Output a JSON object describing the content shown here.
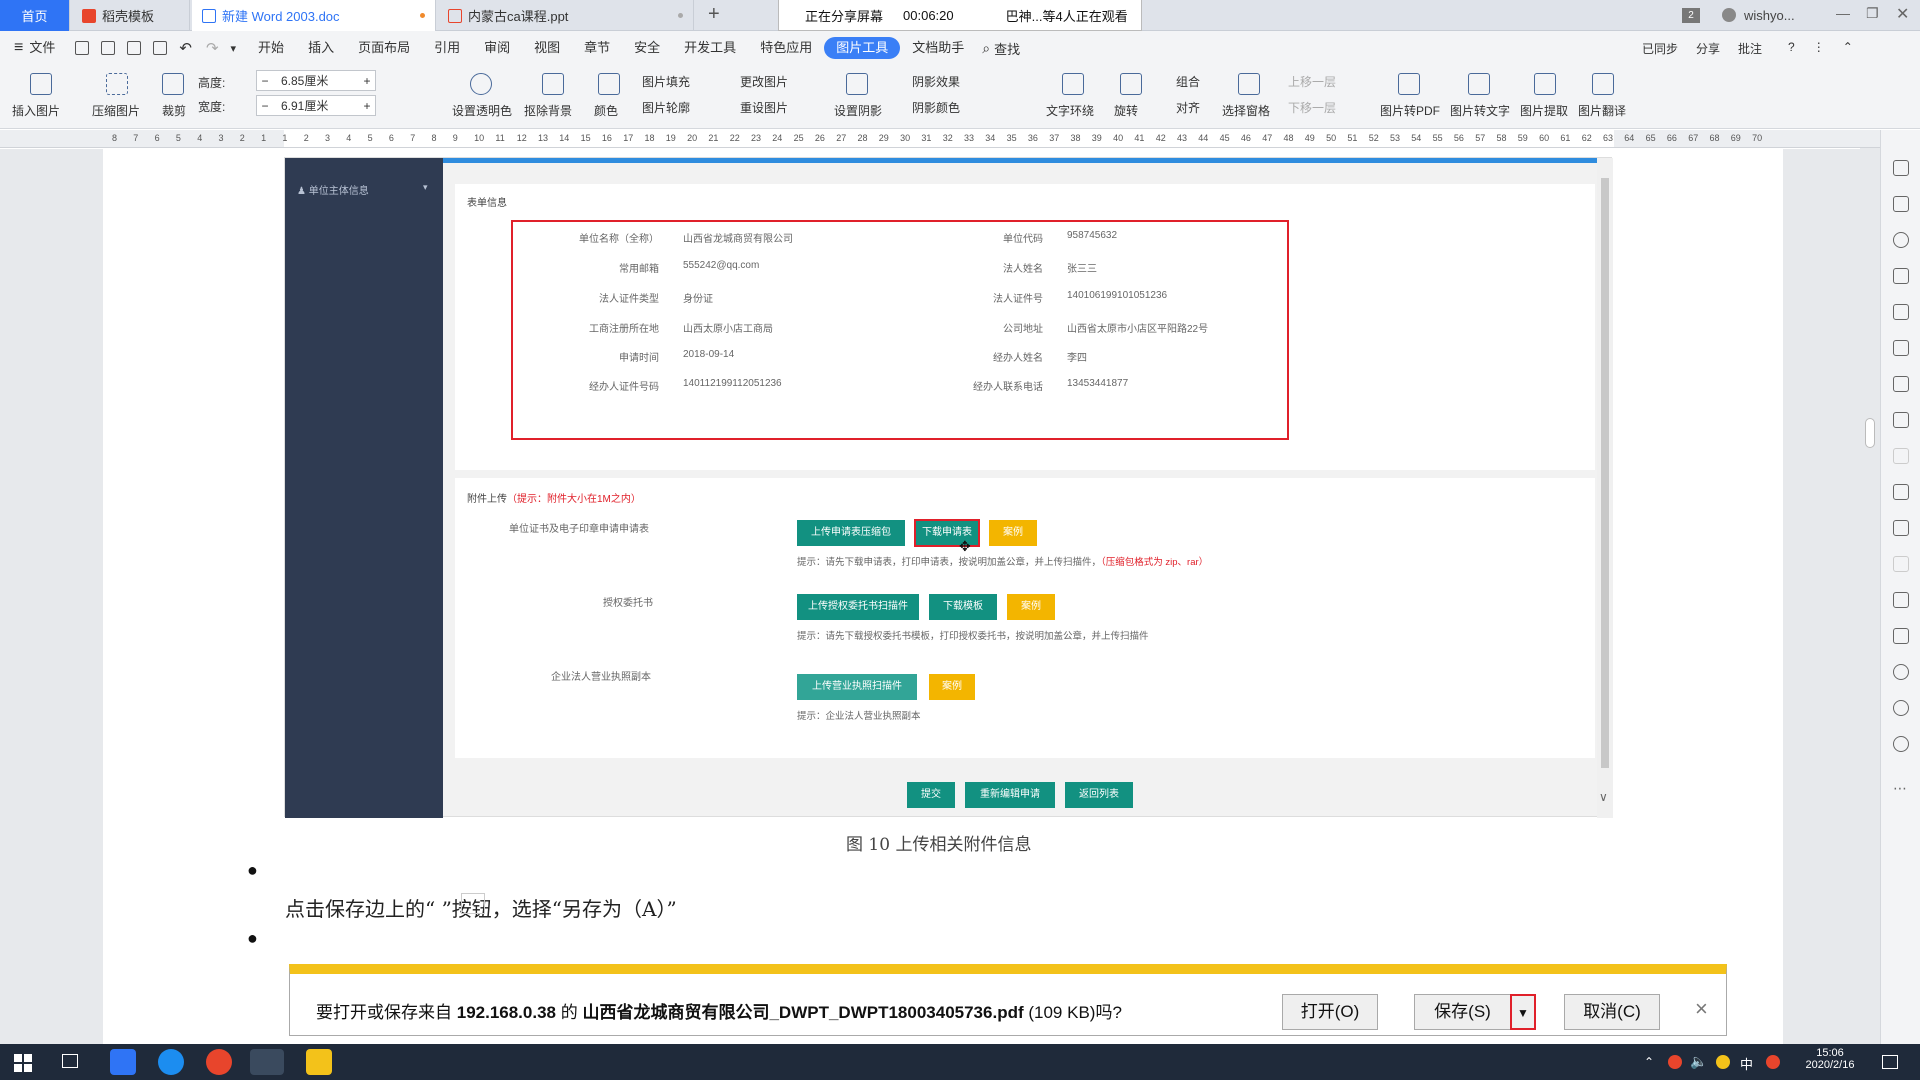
{
  "tabs": {
    "home": "首页",
    "items": [
      {
        "label": "稻壳模板"
      },
      {
        "label": "新建 Word 2003.doc"
      },
      {
        "label": "内蒙古ca课程.ppt"
      }
    ],
    "new_tab": "+",
    "user": "wishyo...",
    "badge": "2"
  },
  "sharing": {
    "status": "正在分享屏幕",
    "time": "00:06:20",
    "viewers": "巴神...等4人正在观看"
  },
  "menu": {
    "file": "文件",
    "items": [
      "开始",
      "插入",
      "页面布局",
      "引用",
      "审阅",
      "视图",
      "章节",
      "安全",
      "开发工具",
      "特色应用",
      "图片工具",
      "文档助手"
    ],
    "active": "图片工具",
    "search": "查找",
    "right": [
      "已同步",
      "分享",
      "批注"
    ]
  },
  "ribbon": {
    "insert_picture": "插入图片",
    "compress": "压缩图片",
    "crop": "裁剪",
    "height_label": "高度:",
    "height_value": "6.85厘米",
    "width_label": "宽度:",
    "width_value": "6.91厘米",
    "transparent": "设置透明色",
    "remove_bg": "抠除背景",
    "color": "颜色",
    "fill": "图片填充",
    "outline": "图片轮廓",
    "change": "更改图片",
    "reset": "重设图片",
    "shadow": "设置阴影",
    "shadow_effect": "阴影效果",
    "shadow_color": "阴影颜色",
    "wrap": "文字环绕",
    "rotate": "旋转",
    "group": "组合",
    "align": "对齐",
    "select_pane": "选择窗格",
    "up": "上移一层",
    "down": "下移一层",
    "to_pdf": "图片转PDF",
    "to_text": "图片转文字",
    "extract": "图片提取",
    "translate": "图片翻译"
  },
  "ruler": {
    "ticks": [
      "8",
      "7",
      "6",
      "5",
      "4",
      "3",
      "2",
      "1",
      "1",
      "2",
      "3",
      "4",
      "5",
      "6",
      "7",
      "8",
      "9",
      "10",
      "11",
      "12",
      "13",
      "14",
      "15",
      "16",
      "17",
      "18",
      "19",
      "20",
      "21",
      "22",
      "23",
      "24",
      "25",
      "26",
      "27",
      "28",
      "29",
      "30",
      "31",
      "32",
      "33",
      "34",
      "35",
      "36",
      "37",
      "38",
      "39",
      "40",
      "41",
      "42",
      "43",
      "44",
      "45",
      "46",
      "47",
      "48",
      "49",
      "50",
      "51",
      "52",
      "53",
      "54",
      "55",
      "56",
      "57",
      "58",
      "59",
      "60",
      "61",
      "62",
      "63",
      "64",
      "65",
      "66",
      "67",
      "68",
      "69",
      "70"
    ]
  },
  "embedded": {
    "sidebar_title": "单位主体信息",
    "form_title": "表单信息",
    "fields": [
      {
        "label": "单位名称（全称）",
        "value": "山西省龙城商贸有限公司",
        "label2": "单位代码",
        "value2": "958745632"
      },
      {
        "label": "常用邮箱",
        "value": "555242@qq.com",
        "label2": "法人姓名",
        "value2": "张三三"
      },
      {
        "label": "法人证件类型",
        "value": "身份证",
        "label2": "法人证件号",
        "value2": "140106199101051236"
      },
      {
        "label": "工商注册所在地",
        "value": "山西太原小店工商局",
        "label2": "公司地址",
        "value2": "山西省太原市小店区平阳路22号"
      },
      {
        "label": "申请时间",
        "value": "2018-09-14",
        "label2": "经办人姓名",
        "value2": "李四"
      },
      {
        "label": "经办人证件号码",
        "value": "140112199112051236",
        "label2": "经办人联系电话",
        "value2": "13453441877"
      }
    ],
    "upload_title": "附件上传",
    "upload_hint": "（提示：附件大小在1M之内）",
    "rows": [
      {
        "label": "单位证书及电子印章申请申请表",
        "buttons": [
          "上传申请表压缩包",
          "下载申请表",
          "案例"
        ],
        "tip": "提示：请先下载申请表，打印申请表，按说明加盖公章，并上传扫描件，",
        "tip_red": "（压缩包格式为 zip、rar）"
      },
      {
        "label": "授权委托书",
        "buttons": [
          "上传授权委托书扫描件",
          "下载模板",
          "案例"
        ],
        "tip": "提示：请先下载授权委托书模板，打印授权委托书，按说明加盖公章，并上传扫描件",
        "tip_red": ""
      },
      {
        "label": "企业法人营业执照副本",
        "buttons": [
          "上传营业执照扫描件",
          "案例"
        ],
        "tip": "提示：企业法人营业执照副本",
        "tip_red": ""
      }
    ],
    "bottom_buttons": [
      "提交",
      "重新编辑申请",
      "返回列表"
    ]
  },
  "caption": "图 10  上传相关附件信息",
  "instruction": "点击保存边上的“   ”按钮，选择“另存为（A）”",
  "download": {
    "prefix": "要打开或保存来自",
    "host": "192.168.0.38",
    "mid": "的",
    "filename": "山西省龙城商贸有限公司_DWPT_DWPT18003405736.pdf",
    "size": "(109 KB)吗?",
    "open": "打开(O)",
    "save": "保存(S)",
    "cancel": "取消(C)",
    "close": "×"
  },
  "taskbar": {
    "ime": "中",
    "time": "15:06",
    "date": "2020/2/16"
  },
  "colors": {
    "accent": "#2f74f5",
    "teal": "#129181",
    "yellow": "#f3b500",
    "red": "#e0202a",
    "sidebar": "#2f3b52"
  }
}
